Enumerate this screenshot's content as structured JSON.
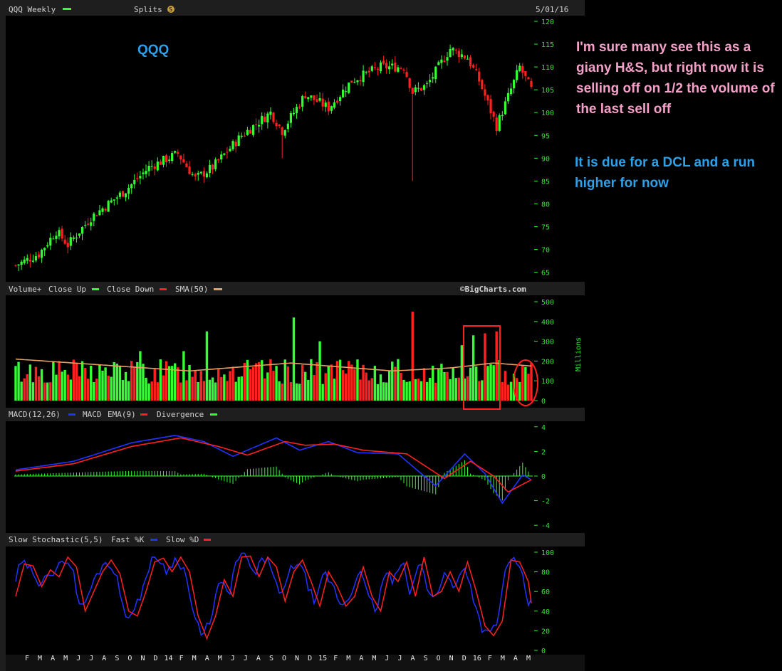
{
  "chart_data": [
    {
      "panel": "price",
      "type": "candlestick",
      "title": "QQQ Weekly",
      "symbol_label": "QQQ",
      "splits_label": "Splits",
      "date_label": "5/01/16",
      "ylim": [
        64,
        120
      ],
      "y_ticks": [
        65,
        70,
        75,
        80,
        85,
        90,
        95,
        100,
        105,
        110,
        115,
        120
      ],
      "anchors": [
        {
          "i": 0,
          "close": 66.5
        },
        {
          "i": 8,
          "close": 69
        },
        {
          "i": 14,
          "close": 74
        },
        {
          "i": 18,
          "close": 71
        },
        {
          "i": 26,
          "close": 77
        },
        {
          "i": 38,
          "close": 83
        },
        {
          "i": 46,
          "close": 88
        },
        {
          "i": 56,
          "close": 91
        },
        {
          "i": 62,
          "close": 85.5
        },
        {
          "i": 68,
          "close": 88
        },
        {
          "i": 78,
          "close": 95
        },
        {
          "i": 88,
          "close": 100
        },
        {
          "i": 92,
          "close": 96
        },
        {
          "i": 100,
          "close": 104
        },
        {
          "i": 108,
          "close": 101
        },
        {
          "i": 116,
          "close": 107
        },
        {
          "i": 126,
          "close": 110
        },
        {
          "i": 134,
          "close": 110
        },
        {
          "i": 137,
          "close": 104.5
        },
        {
          "i": 142,
          "close": 106
        },
        {
          "i": 150,
          "close": 114
        },
        {
          "i": 156,
          "close": 112
        },
        {
          "i": 160,
          "close": 107
        },
        {
          "i": 166,
          "close": 97
        },
        {
          "i": 174,
          "close": 110
        },
        {
          "i": 178,
          "close": 105
        }
      ],
      "lows": [
        {
          "i": 137,
          "low": 85
        },
        {
          "i": 92,
          "low": 90
        },
        {
          "i": 166,
          "low": 95
        }
      ],
      "n_weeks": 179
    },
    {
      "panel": "volume",
      "type": "bar",
      "title": "Volume+",
      "legend": [
        {
          "label": "Close Up",
          "color": "#33ff33"
        },
        {
          "label": "Close Down",
          "color": "#ff2020"
        },
        {
          "label": "SMA(50)",
          "color": "#e8a060"
        }
      ],
      "source": "©BigCharts.com",
      "unit": "Millions",
      "ylim": [
        0,
        500
      ],
      "y_ticks": [
        0,
        100,
        200,
        300,
        400,
        500
      ],
      "baseline": 145,
      "spikes": [
        {
          "i": 43,
          "value": 250
        },
        {
          "i": 58,
          "value": 250
        },
        {
          "i": 66,
          "value": 350
        },
        {
          "i": 96,
          "value": 420
        },
        {
          "i": 105,
          "value": 300
        },
        {
          "i": 137,
          "value": 450
        },
        {
          "i": 154,
          "value": 280
        },
        {
          "i": 158,
          "value": 330
        },
        {
          "i": 162,
          "value": 340
        },
        {
          "i": 166,
          "value": 350
        },
        {
          "i": 176,
          "value": 170
        }
      ],
      "sma50": [
        {
          "i": 0,
          "value": 210
        },
        {
          "i": 30,
          "value": 180
        },
        {
          "i": 60,
          "value": 150
        },
        {
          "i": 95,
          "value": 190
        },
        {
          "i": 130,
          "value": 150
        },
        {
          "i": 150,
          "value": 165
        },
        {
          "i": 165,
          "value": 190
        },
        {
          "i": 178,
          "value": 175
        }
      ]
    },
    {
      "panel": "macd",
      "type": "line",
      "title": "MACD(12,26)",
      "legend": [
        {
          "label": "MACD",
          "color": "#2233ff"
        },
        {
          "label": "EMA(9)",
          "color": "#ff2020"
        },
        {
          "label": "Divergence",
          "color": "#33ff33"
        }
      ],
      "ylim": [
        -4.2,
        4.2
      ],
      "y_ticks": [
        -4,
        -2,
        0,
        2,
        4
      ],
      "macd": [
        {
          "i": 0,
          "value": 0.5
        },
        {
          "i": 20,
          "value": 1.2
        },
        {
          "i": 40,
          "value": 2.7
        },
        {
          "i": 55,
          "value": 3.3
        },
        {
          "i": 65,
          "value": 2.8
        },
        {
          "i": 75,
          "value": 1.6
        },
        {
          "i": 90,
          "value": 3.1
        },
        {
          "i": 98,
          "value": 2.1
        },
        {
          "i": 108,
          "value": 2.8
        },
        {
          "i": 118,
          "value": 1.9
        },
        {
          "i": 132,
          "value": 1.8
        },
        {
          "i": 145,
          "value": -0.8
        },
        {
          "i": 155,
          "value": 1.8
        },
        {
          "i": 162,
          "value": 0.2
        },
        {
          "i": 168,
          "value": -2.2
        },
        {
          "i": 175,
          "value": 0.1
        },
        {
          "i": 178,
          "value": -0.3
        }
      ],
      "signal": [
        {
          "i": 0,
          "value": 0.4
        },
        {
          "i": 20,
          "value": 1.0
        },
        {
          "i": 40,
          "value": 2.4
        },
        {
          "i": 57,
          "value": 3.1
        },
        {
          "i": 70,
          "value": 2.4
        },
        {
          "i": 80,
          "value": 1.7
        },
        {
          "i": 93,
          "value": 2.8
        },
        {
          "i": 100,
          "value": 2.5
        },
        {
          "i": 110,
          "value": 2.6
        },
        {
          "i": 120,
          "value": 2.1
        },
        {
          "i": 135,
          "value": 1.8
        },
        {
          "i": 148,
          "value": -0.2
        },
        {
          "i": 157,
          "value": 1.2
        },
        {
          "i": 165,
          "value": 0.0
        },
        {
          "i": 170,
          "value": -1.3
        },
        {
          "i": 178,
          "value": -0.3
        }
      ]
    },
    {
      "panel": "stochastic",
      "type": "line",
      "title": "Slow Stochastic(5,5)",
      "legend": [
        {
          "label": "Fast %K",
          "color": "#2233ff"
        },
        {
          "label": "Slow %D",
          "color": "#ff2020"
        }
      ],
      "ylim": [
        0,
        100
      ],
      "y_ticks": [
        0,
        20,
        40,
        60,
        80,
        100
      ],
      "d_points": [
        {
          "i": 0,
          "value": 55
        },
        {
          "i": 3,
          "value": 88
        },
        {
          "i": 6,
          "value": 86
        },
        {
          "i": 9,
          "value": 65
        },
        {
          "i": 12,
          "value": 82
        },
        {
          "i": 15,
          "value": 75
        },
        {
          "i": 18,
          "value": 95
        },
        {
          "i": 21,
          "value": 85
        },
        {
          "i": 24,
          "value": 40
        },
        {
          "i": 27,
          "value": 60
        },
        {
          "i": 30,
          "value": 80
        },
        {
          "i": 33,
          "value": 92
        },
        {
          "i": 36,
          "value": 78
        },
        {
          "i": 39,
          "value": 40
        },
        {
          "i": 42,
          "value": 35
        },
        {
          "i": 45,
          "value": 60
        },
        {
          "i": 48,
          "value": 90
        },
        {
          "i": 51,
          "value": 94
        },
        {
          "i": 54,
          "value": 80
        },
        {
          "i": 57,
          "value": 95
        },
        {
          "i": 60,
          "value": 80
        },
        {
          "i": 63,
          "value": 35
        },
        {
          "i": 66,
          "value": 12
        },
        {
          "i": 69,
          "value": 35
        },
        {
          "i": 72,
          "value": 72
        },
        {
          "i": 75,
          "value": 55
        },
        {
          "i": 78,
          "value": 95
        },
        {
          "i": 81,
          "value": 96
        },
        {
          "i": 84,
          "value": 75
        },
        {
          "i": 87,
          "value": 95
        },
        {
          "i": 90,
          "value": 85
        },
        {
          "i": 93,
          "value": 50
        },
        {
          "i": 96,
          "value": 80
        },
        {
          "i": 99,
          "value": 92
        },
        {
          "i": 102,
          "value": 70
        },
        {
          "i": 105,
          "value": 45
        },
        {
          "i": 108,
          "value": 80
        },
        {
          "i": 111,
          "value": 65
        },
        {
          "i": 114,
          "value": 45
        },
        {
          "i": 117,
          "value": 55
        },
        {
          "i": 120,
          "value": 85
        },
        {
          "i": 123,
          "value": 55
        },
        {
          "i": 126,
          "value": 40
        },
        {
          "i": 129,
          "value": 80
        },
        {
          "i": 132,
          "value": 70
        },
        {
          "i": 135,
          "value": 90
        },
        {
          "i": 138,
          "value": 55
        },
        {
          "i": 141,
          "value": 95
        },
        {
          "i": 144,
          "value": 55
        },
        {
          "i": 147,
          "value": 60
        },
        {
          "i": 150,
          "value": 80
        },
        {
          "i": 153,
          "value": 60
        },
        {
          "i": 156,
          "value": 90
        },
        {
          "i": 159,
          "value": 60
        },
        {
          "i": 162,
          "value": 25
        },
        {
          "i": 165,
          "value": 15
        },
        {
          "i": 168,
          "value": 30
        },
        {
          "i": 171,
          "value": 92
        },
        {
          "i": 174,
          "value": 90
        },
        {
          "i": 177,
          "value": 70
        },
        {
          "i": 178,
          "value": 48
        }
      ],
      "x_tick_labels": [
        "F",
        "M",
        "A",
        "M",
        "J",
        "J",
        "A",
        "S",
        "O",
        "N",
        "D",
        "14",
        "F",
        "M",
        "A",
        "M",
        "J",
        "J",
        "A",
        "S",
        "O",
        "N",
        "D",
        "15",
        "F",
        "M",
        "A",
        "M",
        "J",
        "J",
        "A",
        "S",
        "O",
        "N",
        "D",
        "16",
        "F",
        "M",
        "A",
        "M"
      ]
    }
  ],
  "annotations": {
    "note1": "I'm sure many see this as a giany H&S, but right now  it is selling off on 1/2 the volume of the last sell off",
    "note2": "It is due for a DCL and a run higher for now"
  },
  "colors": {
    "up": "#33ff33",
    "down": "#ff2020",
    "macd": "#2233ff",
    "signal": "#ff2020",
    "highlight": "#ff2020"
  }
}
